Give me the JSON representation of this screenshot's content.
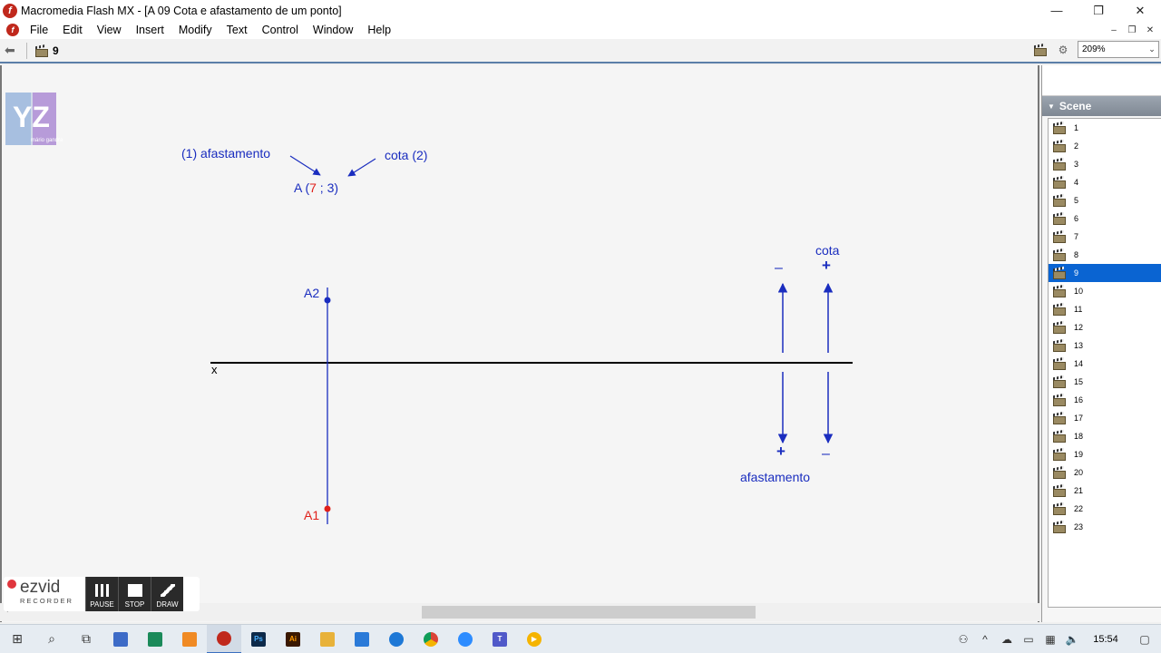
{
  "window": {
    "title": "Macromedia Flash MX - [A 09 Cota e afastamento de um ponto]",
    "app_icon": "flash-icon",
    "controls": [
      "—",
      "❐",
      "✕"
    ]
  },
  "menu": {
    "items": [
      "File",
      "Edit",
      "View",
      "Insert",
      "Modify",
      "Text",
      "Control",
      "Window",
      "Help"
    ],
    "doc_controls": [
      "–",
      "❐",
      "✕"
    ]
  },
  "editbar": {
    "current_scene": "9",
    "zoom": "209%"
  },
  "stage": {
    "logo_text": "mário gandra",
    "notation_left": "(1) afastamento",
    "notation_right": "cota (2)",
    "point_prefix": "A (",
    "point_value_1": "7",
    "point_separator": " ; ",
    "point_value_2": "3",
    "point_suffix": ")",
    "label_a2": "A2",
    "label_a1": "A1",
    "axis_label": "x",
    "cota_label": "cota",
    "afastamento_label": "afastamento",
    "minus_top": "–",
    "plus_top": "+",
    "plus_bottom": "+",
    "minus_bottom": "–",
    "colors": {
      "blue": "#1a2dbf",
      "red": "#e0201a",
      "axis": "#000000"
    }
  },
  "scene_panel": {
    "title": "Scene",
    "scenes": [
      "1",
      "2",
      "3",
      "4",
      "5",
      "6",
      "7",
      "8",
      "9",
      "10",
      "11",
      "12",
      "13",
      "14",
      "15",
      "16",
      "17",
      "18",
      "19",
      "20",
      "21",
      "22",
      "23"
    ],
    "selected": "9"
  },
  "ezvid": {
    "logo": "ezvid",
    "sub": "RECORDER",
    "pause": "PAUSE",
    "stop": "STOP",
    "draw": "DRAW"
  },
  "taskbar": {
    "clock": "15:54"
  }
}
